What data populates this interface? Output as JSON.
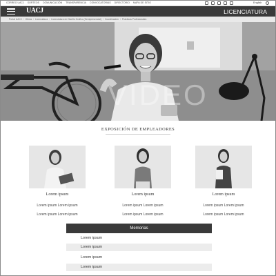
{
  "utility_bar": {
    "links": [
      "CORREO UACJ",
      "SORTEOS",
      "COMUNICACIÓN",
      "TRANSPARENCIA",
      "CONVOCATORIAS",
      "DIRECTORIO",
      "MAPA DE SITIO"
    ],
    "language": "English",
    "social_icons": [
      "social-icon-1",
      "social-icon-2",
      "social-icon-3",
      "social-icon-4",
      "social-icon-5"
    ]
  },
  "header": {
    "logo": "UACJ",
    "title": "LICENCIATURA",
    "menu_icon": "hamburger-menu-icon"
  },
  "breadcrumb": {
    "items": [
      "Portal UACJ",
      "Oferta",
      "Licenciatura",
      "Licenciatura en Diseño Gráfico (Semipresencial)",
      "Coordinación",
      "Prácticas Profesionales"
    ]
  },
  "hero": {
    "overlay_text": "VIDEO"
  },
  "employers": {
    "title": "EXPOSICIÓN DE EMPLEADORES",
    "cards": [
      {
        "name": "Lorem ipsum",
        "lines": [
          "Lorem ipsum Lorem ipsum",
          "Lorem ipsum Lorem ipsum"
        ]
      },
      {
        "name": "Lorem ipsum",
        "lines": [
          "Lorem ipsum Lorem ipsum",
          "Lorem ipsum Lorem ipsum"
        ]
      },
      {
        "name": "Lorem ipsum",
        "lines": [
          "Lorem ipsum Lorem ipsum",
          "Lorem ipsum Lorem ipsum"
        ]
      }
    ]
  },
  "memorias": {
    "title": "Memorias",
    "items": [
      "Lorem ipsum",
      "Lorem ipsum",
      "Lorem ipsum",
      "Lorem ipsum"
    ]
  }
}
